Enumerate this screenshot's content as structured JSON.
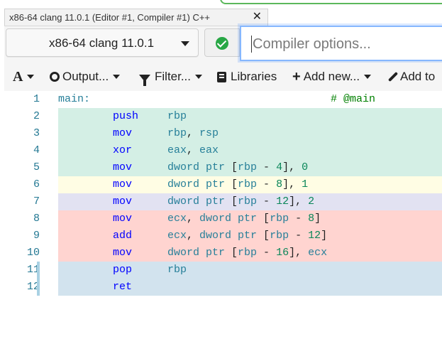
{
  "tab": {
    "title": "x86-64 clang 11.0.1 (Editor #1, Compiler #1) C++",
    "close": "✕"
  },
  "compiler": {
    "name": "x86-64 clang 11.0.1",
    "options_placeholder": "Compiler options..."
  },
  "toolbar": {
    "font": "A",
    "output": "Output...",
    "filter": "Filter...",
    "libraries": "Libraries",
    "add_new": "Add new...",
    "add_tool": "Add to"
  },
  "code": {
    "lines": [
      {
        "n": "1",
        "label": "main:",
        "comment": "# @main",
        "bg": "none"
      },
      {
        "n": "2",
        "op": "push",
        "args": [
          {
            "t": "reg",
            "v": "rbp"
          }
        ],
        "bg": "green"
      },
      {
        "n": "3",
        "op": "mov",
        "args": [
          {
            "t": "reg",
            "v": "rbp"
          },
          {
            "t": "plain",
            "v": ", "
          },
          {
            "t": "reg",
            "v": "rsp"
          }
        ],
        "bg": "green"
      },
      {
        "n": "4",
        "op": "xor",
        "args": [
          {
            "t": "reg",
            "v": "eax"
          },
          {
            "t": "plain",
            "v": ", "
          },
          {
            "t": "reg",
            "v": "eax"
          }
        ],
        "bg": "green"
      },
      {
        "n": "5",
        "op": "mov",
        "args": [
          {
            "t": "kw",
            "v": "dword ptr"
          },
          {
            "t": "plain",
            "v": " ["
          },
          {
            "t": "reg",
            "v": "rbp"
          },
          {
            "t": "plain",
            "v": " - "
          },
          {
            "t": "num",
            "v": "4"
          },
          {
            "t": "plain",
            "v": "], "
          },
          {
            "t": "num",
            "v": "0"
          }
        ],
        "bg": "green"
      },
      {
        "n": "6",
        "op": "mov",
        "args": [
          {
            "t": "kw",
            "v": "dword ptr"
          },
          {
            "t": "plain",
            "v": " ["
          },
          {
            "t": "reg",
            "v": "rbp"
          },
          {
            "t": "plain",
            "v": " - "
          },
          {
            "t": "num",
            "v": "8"
          },
          {
            "t": "plain",
            "v": "], "
          },
          {
            "t": "num",
            "v": "1"
          }
        ],
        "bg": "yellow"
      },
      {
        "n": "7",
        "op": "mov",
        "args": [
          {
            "t": "kw",
            "v": "dword ptr"
          },
          {
            "t": "plain",
            "v": " ["
          },
          {
            "t": "reg",
            "v": "rbp"
          },
          {
            "t": "plain",
            "v": " - "
          },
          {
            "t": "num",
            "v": "12"
          },
          {
            "t": "plain",
            "v": "], "
          },
          {
            "t": "num",
            "v": "2"
          }
        ],
        "bg": "lav"
      },
      {
        "n": "8",
        "op": "mov",
        "args": [
          {
            "t": "reg",
            "v": "ecx"
          },
          {
            "t": "plain",
            "v": ", "
          },
          {
            "t": "kw",
            "v": "dword ptr"
          },
          {
            "t": "plain",
            "v": " ["
          },
          {
            "t": "reg",
            "v": "rbp"
          },
          {
            "t": "plain",
            "v": " - "
          },
          {
            "t": "num",
            "v": "8"
          },
          {
            "t": "plain",
            "v": "]"
          }
        ],
        "bg": "red"
      },
      {
        "n": "9",
        "op": "add",
        "args": [
          {
            "t": "reg",
            "v": "ecx"
          },
          {
            "t": "plain",
            "v": ", "
          },
          {
            "t": "kw",
            "v": "dword ptr"
          },
          {
            "t": "plain",
            "v": " ["
          },
          {
            "t": "reg",
            "v": "rbp"
          },
          {
            "t": "plain",
            "v": " - "
          },
          {
            "t": "num",
            "v": "12"
          },
          {
            "t": "plain",
            "v": "]"
          }
        ],
        "bg": "red"
      },
      {
        "n": "10",
        "op": "mov",
        "args": [
          {
            "t": "kw",
            "v": "dword ptr"
          },
          {
            "t": "plain",
            "v": " ["
          },
          {
            "t": "reg",
            "v": "rbp"
          },
          {
            "t": "plain",
            "v": " - "
          },
          {
            "t": "num",
            "v": "16"
          },
          {
            "t": "plain",
            "v": "], "
          },
          {
            "t": "reg",
            "v": "ecx"
          }
        ],
        "bg": "red"
      },
      {
        "n": "11",
        "op": "pop",
        "args": [
          {
            "t": "reg",
            "v": "rbp"
          }
        ],
        "bg": "blue",
        "mark": true
      },
      {
        "n": "12",
        "op": "ret",
        "args": [],
        "bg": "blue",
        "mark": true
      }
    ]
  },
  "colors": {
    "green": "#d4efe5",
    "yellow": "#fffde4",
    "lavender": "#e2e2f2",
    "red": "#ffd4d0",
    "blue": "#d2e3ee",
    "focus_ring": "#86b7fe",
    "status_ok": "#28a745"
  },
  "icons": [
    "close-icon",
    "chevron-down-icon",
    "check-circle-icon",
    "font-size-icon",
    "gear-icon",
    "filter-icon",
    "book-icon",
    "plus-icon",
    "brush-icon"
  ]
}
